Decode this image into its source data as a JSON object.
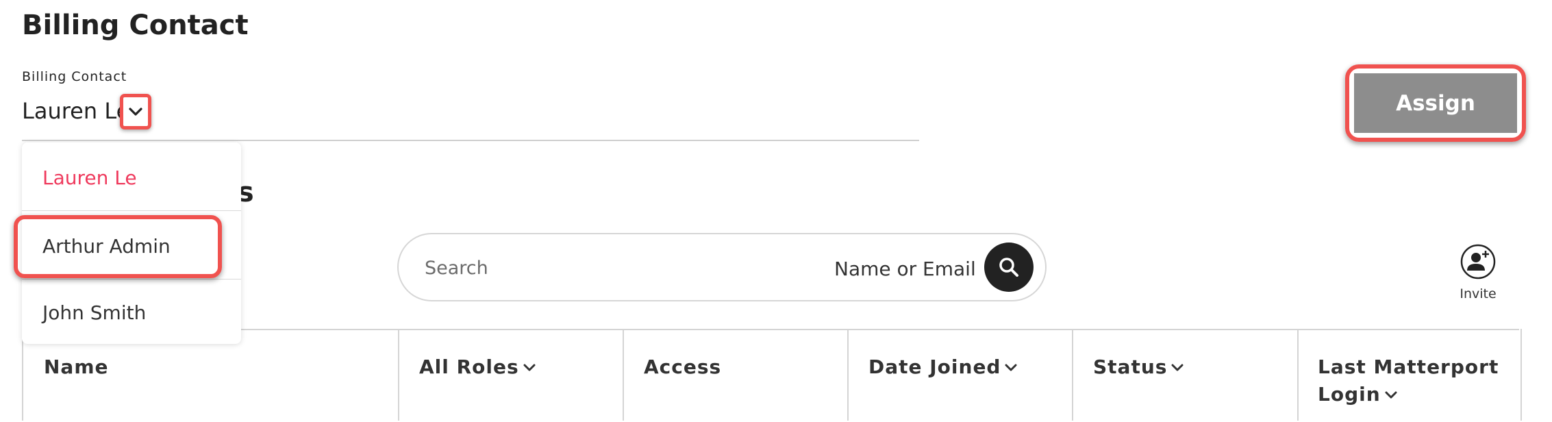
{
  "billing": {
    "title": "Billing Contact",
    "field_label": "Billing Contact",
    "selected": "Lauren Le",
    "assign_label": "Assign",
    "options": [
      "Lauren Le",
      "Arthur Admin",
      "John Smith"
    ]
  },
  "users": {
    "heading_visible": "ers"
  },
  "search": {
    "placeholder": "Search",
    "hint": "Name or Email"
  },
  "invite": {
    "label": "Invite"
  },
  "table": {
    "headers": [
      "Name",
      "All Roles",
      "Access",
      "Date Joined",
      "Status",
      "Last Matterport",
      "Login"
    ]
  },
  "colors": {
    "highlight": "#f0524f",
    "selected_option": "#ef3a5d",
    "assign_bg": "#8d8d8d"
  }
}
